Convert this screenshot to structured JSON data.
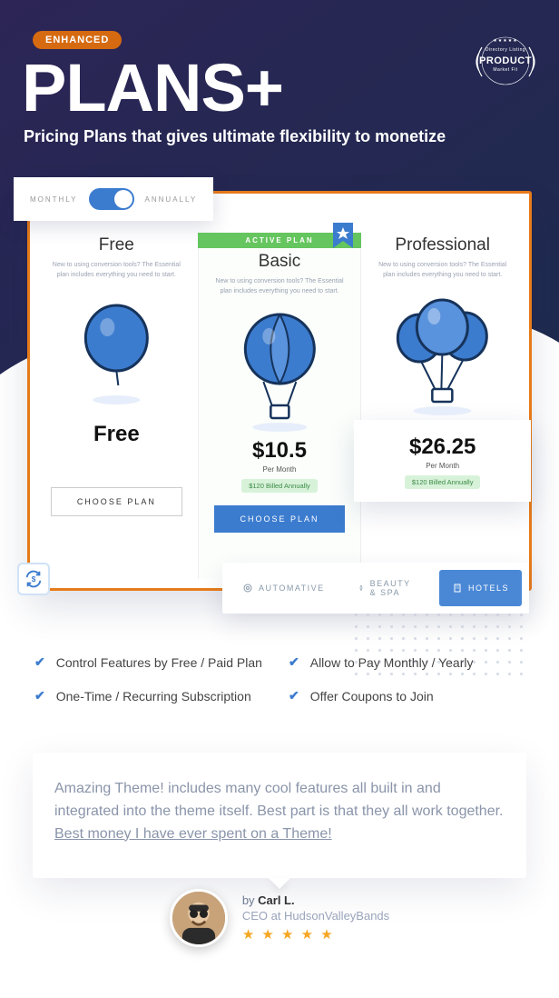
{
  "hero": {
    "badge": "ENHANCED",
    "title": "PLANS+",
    "subtitle": "Pricing Plans that gives ultimate flexibility to monetize",
    "seal": {
      "stars": "★★★★★",
      "top": "Directory Listing",
      "mid": "PRODUCT",
      "bot": "Market Fit"
    }
  },
  "toggle": {
    "left": "MONTHLY",
    "right": "ANNUALLY"
  },
  "plans": {
    "free": {
      "name": "Free",
      "desc": "New to using conversion tools? The Essential plan includes everything you need to start.",
      "price": "Free",
      "button": "CHOOSE PLAN"
    },
    "basic": {
      "ribbon": "ACTIVE PLAN",
      "name": "Basic",
      "desc": "New to using conversion tools? The Essential plan includes everything you need to start.",
      "price": "$10.5",
      "per": "Per Month",
      "billed": "$120 Billed Annually",
      "button": "CHOOSE PLAN"
    },
    "pro": {
      "name": "Professional",
      "desc": "New to using conversion tools? The Essential plan includes everything you need to start.",
      "price": "$26.25",
      "per": "Per Month",
      "billed": "$120 Billed Annually"
    }
  },
  "categories": {
    "a": "AUTOMATIVE",
    "b": "BEAUTY & SPA",
    "c": "HOTELS"
  },
  "features": {
    "f1": "Control Features by Free / Paid Plan",
    "f2": "Allow to Pay Monthly / Yearly",
    "f3": "One-Time / Recurring Subscription",
    "f4": "Offer Coupons to Join"
  },
  "testimonial": {
    "text_a": "Amazing Theme! includes many cool features all built in and integrated into the theme itself. Best part is that they all work together. ",
    "text_hl": "Best money I have ever spent on a Theme! ",
    "by": "by ",
    "name": "Carl L.",
    "role": "CEO at HudsonValleyBands",
    "stars": "★ ★ ★ ★ ★"
  }
}
